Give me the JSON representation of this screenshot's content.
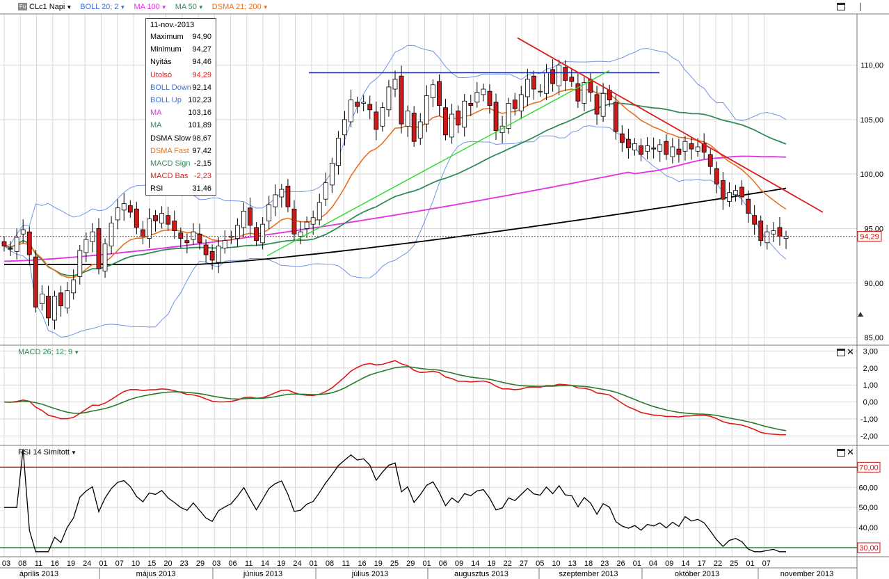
{
  "toolbar": {
    "icon": "Fu",
    "symbol": "CLc1 Napi",
    "boll": "BOLL 20; 2",
    "ma100": "MA 100",
    "ma50": "MA 50",
    "dsma": "DSMA 21; 200",
    "colors": {
      "boll": "#3b6fd8",
      "ma100": "#e030e0",
      "ma50": "#2e8b57",
      "dsma": "#e87020"
    }
  },
  "infobox": {
    "date": "11-nov.-2013",
    "rows": [
      {
        "label": "Maximum",
        "value": "94,90",
        "color": "#000000"
      },
      {
        "label": "Minimum",
        "value": "94,27",
        "color": "#000000"
      },
      {
        "label": "Nyitás",
        "value": "94,46",
        "color": "#000000"
      },
      {
        "label": "Utolsó",
        "value": "94,29",
        "color": "#e02020"
      },
      {
        "label": "BOLL Down",
        "value": "92,14",
        "color": "#3b6fd8"
      },
      {
        "label": "BOLL Up",
        "value": "102,23",
        "color": "#3b6fd8"
      },
      {
        "label": "MA",
        "value": "103,16",
        "color": "#e030e0"
      },
      {
        "label": "MA",
        "value": "101,89",
        "color": "#2e8b57"
      },
      {
        "label": "DSMA Slow",
        "value": "98,67",
        "color": "#000000"
      },
      {
        "label": "DSMA Fast",
        "value": "97,42",
        "color": "#e87020"
      },
      {
        "label": "MACD Sign",
        "value": "-2,15",
        "color": "#2e8b57"
      },
      {
        "label": "MACD Bas",
        "value": "-2,23",
        "color": "#e02020"
      },
      {
        "label": "RSI",
        "value": "31,46",
        "color": "#000000"
      }
    ]
  },
  "macd_label": "MACD 26; 12; 9",
  "rsi_label": "RSI 14 Simított",
  "chart_data": [
    {
      "type": "candlestick",
      "yticks": [
        "85,00",
        "90,00",
        "95,00",
        "100,00",
        "105,00",
        "110,00"
      ],
      "ytick_values": [
        85,
        90,
        95,
        100,
        105,
        110
      ],
      "ylim": [
        84.3,
        114.7
      ],
      "last_price_label": "94,29",
      "last_price": 94.29,
      "close": [
        93.4,
        93.1,
        94.2,
        94.9,
        92.6,
        87.8,
        89.0,
        86.8,
        88.8,
        87.9,
        89.3,
        90.3,
        93.0,
        94.0,
        94.7,
        91.3,
        93.6,
        95.5,
        96.9,
        97.3,
        96.5,
        95.1,
        94.3,
        95.9,
        95.7,
        96.4,
        95.4,
        94.8,
        94.1,
        93.7,
        94.7,
        93.7,
        92.6,
        92.1,
        93.4,
        93.9,
        94.3,
        95.3,
        96.6,
        95.3,
        93.9,
        95.4,
        97.2,
        98.1,
        98.6,
        97.0,
        94.5,
        94.7,
        95.6,
        96.0,
        97.4,
        99.2,
        101.0,
        103.3,
        105.0,
        106.8,
        106.2,
        106.6,
        105.9,
        104.1,
        106.1,
        108.0,
        108.7,
        104.6,
        105.8,
        103.0,
        104.8,
        107.2,
        108.2,
        106.3,
        103.6,
        105.5,
        104.5,
        106.7,
        106.3,
        107.5,
        107.8,
        106.3,
        104.0,
        104.4,
        106.5,
        106.0,
        107.3,
        108.7,
        107.8,
        107.6,
        109.3,
        108.3,
        110.0,
        108.6,
        108.5,
        106.7,
        108.4,
        107.5,
        105.5,
        107.4,
        106.8,
        103.9,
        102.9,
        102.4,
        102.8,
        101.8,
        102.6,
        102.3,
        102.7,
        101.8,
        102.5,
        101.8,
        103.0,
        102.3,
        102.5,
        102.0,
        100.7,
        99.1,
        97.7,
        98.3,
        98.5,
        97.9,
        96.4,
        95.4,
        93.9,
        94.7,
        94.8,
        94.3,
        94.3
      ],
      "xticks": [
        "03",
        "08",
        "11",
        "16",
        "19",
        "24",
        "01",
        "07",
        "10",
        "15",
        "20",
        "23",
        "29",
        "03",
        "06",
        "11",
        "14",
        "19",
        "24",
        "01",
        "08",
        "11",
        "16",
        "19",
        "25",
        "29",
        "01",
        "06",
        "09",
        "14",
        "19",
        "22",
        "27",
        "05",
        "10",
        "13",
        "18",
        "23",
        "26",
        "01",
        "04",
        "09",
        "14",
        "17",
        "22",
        "25",
        "01",
        "07"
      ],
      "months": [
        "április 2013",
        "május 2013",
        "június 2013",
        "július 2013",
        "augusztus 2013",
        "szeptember 2013",
        "október 2013",
        "november 2013"
      ],
      "series": [
        {
          "name": "BOLL 20; 2"
        },
        {
          "name": "MA 100"
        },
        {
          "name": "MA 50"
        },
        {
          "name": "DSMA 21; 200"
        }
      ],
      "grid": true
    },
    {
      "type": "line",
      "title": "MACD 26; 12; 9",
      "yticks": [
        "-2,00",
        "-1,00",
        "0,00",
        "1,00",
        "2,00",
        "3,00"
      ],
      "ytick_values": [
        -2,
        -1,
        0,
        1,
        2,
        3
      ],
      "ylim": [
        -2.55,
        3.3
      ],
      "grid": true
    },
    {
      "type": "line",
      "title": "RSI 14 Simított",
      "yticks": [
        "30,00",
        "40,00",
        "50,00",
        "60,00",
        "70,00"
      ],
      "ytick_values": [
        30,
        40,
        50,
        60,
        70
      ],
      "ylim": [
        25.5,
        80.5
      ],
      "levels": [
        {
          "label": "70,00",
          "value": 70
        },
        {
          "label": "30,00",
          "value": 30
        }
      ],
      "grid": true
    }
  ]
}
